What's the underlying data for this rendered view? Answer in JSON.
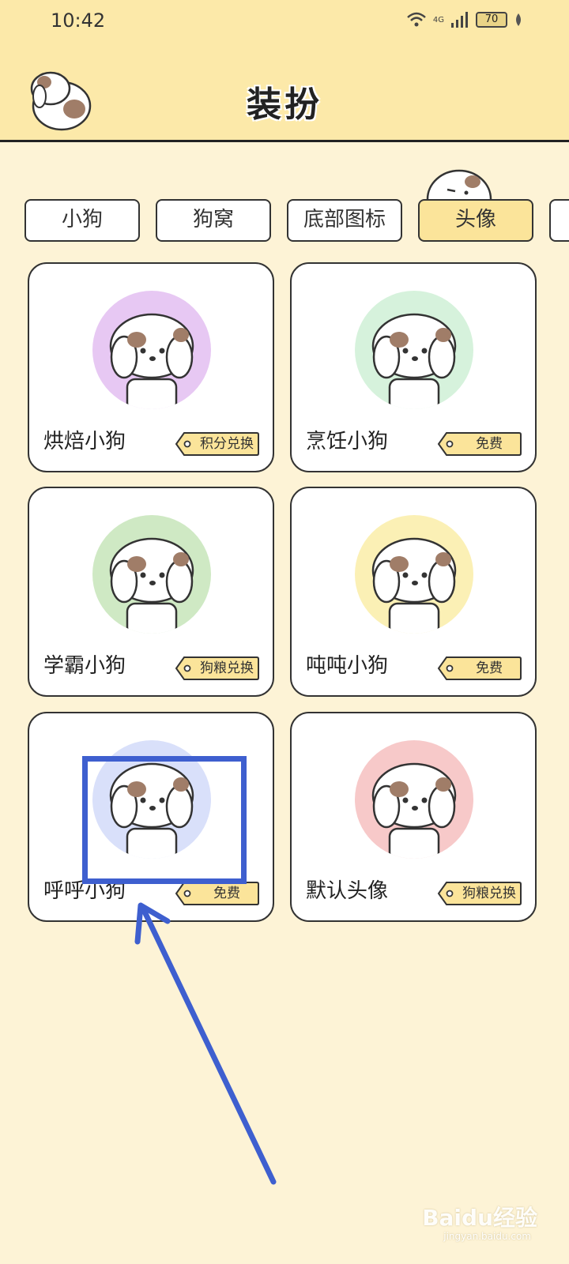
{
  "status_bar": {
    "time": "10:42",
    "network": "4G",
    "battery": "70"
  },
  "header": {
    "title": "装扮"
  },
  "tabs": [
    {
      "label": "小狗",
      "active": false
    },
    {
      "label": "狗窝",
      "active": false
    },
    {
      "label": "底部图标",
      "active": false
    },
    {
      "label": "头像",
      "active": true
    }
  ],
  "avatars": [
    {
      "name": "烘焙小狗",
      "tag": "积分兑换",
      "bg": "#e7c8f3"
    },
    {
      "name": "烹饪小狗",
      "tag": "免费",
      "bg": "#d6f2dc"
    },
    {
      "name": "学霸小狗",
      "tag": "狗粮兑换",
      "bg": "#cfe9c4"
    },
    {
      "name": "吨吨小狗",
      "tag": "免费",
      "bg": "#fbf0b5"
    },
    {
      "name": "呼呼小狗",
      "tag": "免费",
      "bg": "#d9e0fa"
    },
    {
      "name": "默认头像",
      "tag": "狗粮兑换",
      "bg": "#f7c9c9"
    }
  ],
  "colors": {
    "header_bg": "#fce9a9",
    "page_bg": "#fdf3d6",
    "tag_bg": "#fbe49a",
    "annotation": "#3e5fcf"
  },
  "watermark": {
    "brand": "Baidu经验",
    "url": "jingyan.baidu.com"
  }
}
